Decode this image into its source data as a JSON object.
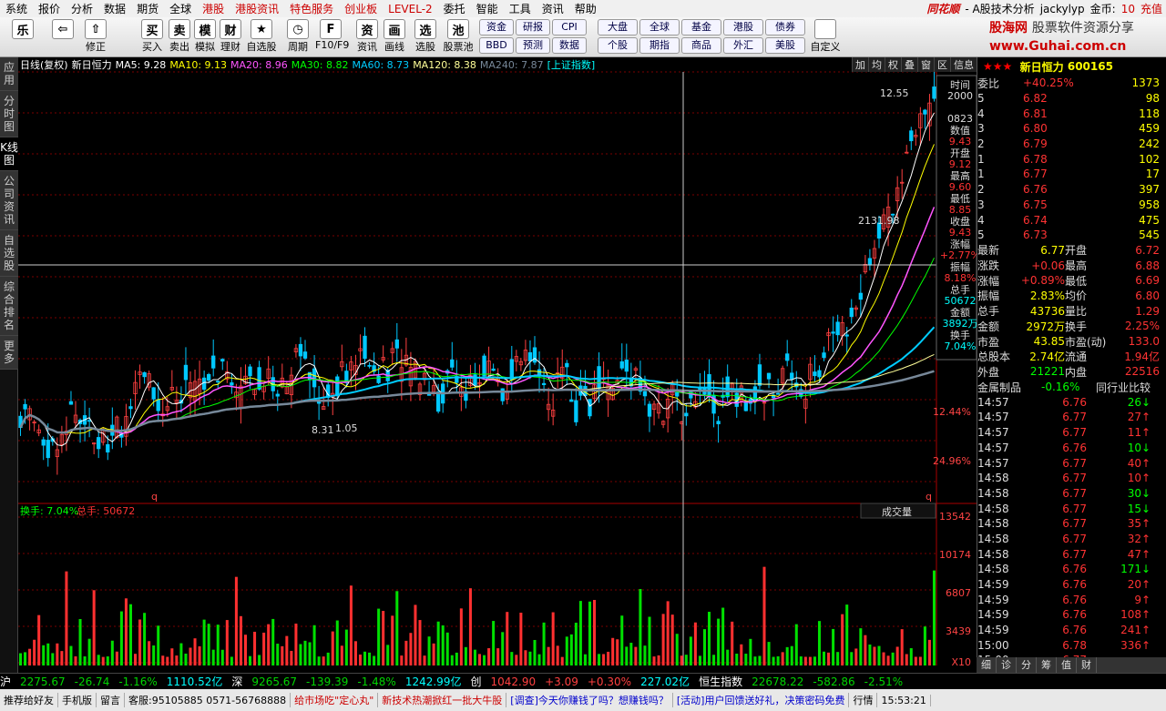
{
  "menu": [
    "系统",
    "报价",
    "分析",
    "数据",
    "期货",
    "全球",
    "港股",
    "港股资讯",
    "特色服务",
    "创业板",
    "LEVEL-2",
    "委托",
    "智能",
    "工具",
    "资讯",
    "帮助"
  ],
  "menu_red": [
    6,
    7,
    8,
    9,
    10
  ],
  "brand": "同花顺",
  "app_sub": "- A股技术分析",
  "user": "jackylyp",
  "coins_label": "金币:",
  "coins": "10",
  "recharge": "充值",
  "logo": {
    "line1": "股海网",
    "line2": "股票软件资源分享",
    "url": "www.Guhai.com.cn"
  },
  "toolbar": [
    {
      "icon": "乐",
      "label": ""
    },
    {
      "icon": "⇦",
      "label": ""
    },
    {
      "icon": "⇧",
      "label": "修正"
    },
    {
      "icon": "买",
      "label": "买入"
    },
    {
      "icon": "卖",
      "label": "卖出"
    },
    {
      "icon": "模",
      "label": "模拟"
    },
    {
      "icon": "财",
      "label": "理财"
    },
    {
      "icon": "★",
      "label": "自选股"
    },
    {
      "icon": "◷",
      "label": "周期"
    },
    {
      "icon": "F",
      "label": "F10/F9"
    },
    {
      "icon": "资",
      "label": "资讯"
    },
    {
      "icon": "画",
      "label": "画线"
    },
    {
      "icon": "选",
      "label": "选股"
    },
    {
      "icon": "池",
      "label": "股票池"
    }
  ],
  "toolbar_grid1": [
    "资金",
    "研报",
    "CPI",
    "BBD",
    "预测",
    "数据"
  ],
  "toolbar_grid2": [
    "大盘",
    "全球",
    "基金",
    "港股",
    "债券",
    "个股",
    "期指",
    "商品",
    "外汇",
    "美股"
  ],
  "toolbar_custom": "自定义",
  "sidebar": [
    "应用",
    "分时图",
    "K线图",
    "公司资讯",
    "自选股",
    "综合排名",
    "更多"
  ],
  "kline": {
    "period": "日线(复权)",
    "name": "新日恒力",
    "ma": [
      {
        "label": "MA5: 9.28",
        "color": "#ffffff"
      },
      {
        "label": "MA10: 9.13",
        "color": "#ffff00"
      },
      {
        "label": "MA20: 8.96",
        "color": "#ff55ff"
      },
      {
        "label": "MA30: 8.82",
        "color": "#00ff00"
      },
      {
        "label": "MA60: 8.73",
        "color": "#00ccff"
      },
      {
        "label": "MA120: 8.38",
        "color": "#ffff99"
      },
      {
        "label": "MA240: 7.87",
        "color": "#778899"
      }
    ],
    "overlay": "[上证指数]",
    "buttons": [
      "加",
      "均",
      "权",
      "叠",
      "窗",
      "区",
      "信息"
    ],
    "high_label": "12.55",
    "mid_label": "2131.98",
    "low_label": "8.31",
    "low2": "1.05",
    "pct_labels": [
      "12.44%",
      "24.96%"
    ],
    "q_left": "q",
    "q_right": "q"
  },
  "tooltip": [
    {
      "k": "时间",
      "v": "2000"
    },
    {
      "k": "",
      "v": "0823"
    },
    {
      "k": "数值",
      "v": "9.43"
    },
    {
      "k": "开盘",
      "v": "9.12"
    },
    {
      "k": "最高",
      "v": "9.60"
    },
    {
      "k": "最低",
      "v": "8.85"
    },
    {
      "k": "收盘",
      "v": "9.43"
    },
    {
      "k": "涨幅",
      "v": "+2.77%"
    },
    {
      "k": "振幅",
      "v": "8.18%"
    },
    {
      "k": "总手",
      "v": "50672"
    },
    {
      "k": "金额",
      "v": "3892万"
    },
    {
      "k": "换手",
      "v": "7.04%"
    }
  ],
  "volume": {
    "title_a": "换手: 7.04%",
    "title_b": "总手: 50672",
    "indicator": "成交量",
    "axis": [
      "13542",
      "10174",
      "6807",
      "3439",
      "X10"
    ]
  },
  "quote": {
    "stars": "★★★",
    "name": "新日恒力",
    "code": "600165",
    "webi_k": "委比",
    "webi": "+40.25%",
    "webi_v": "1373",
    "sells": [
      [
        "5",
        "6.82",
        "98"
      ],
      [
        "4",
        "6.81",
        "118"
      ],
      [
        "3",
        "6.80",
        "459"
      ],
      [
        "2",
        "6.79",
        "242"
      ],
      [
        "1",
        "6.78",
        "102"
      ]
    ],
    "buys": [
      [
        "1",
        "6.77",
        "17"
      ],
      [
        "2",
        "6.76",
        "397"
      ],
      [
        "3",
        "6.75",
        "958"
      ],
      [
        "4",
        "6.74",
        "475"
      ],
      [
        "5",
        "6.73",
        "545"
      ]
    ],
    "stats": [
      [
        "最新",
        "6.77",
        "开盘",
        "6.72"
      ],
      [
        "涨跌",
        "+0.06",
        "最高",
        "6.88"
      ],
      [
        "涨幅",
        "+0.89%",
        "最低",
        "6.69"
      ],
      [
        "振幅",
        "2.83%",
        "均价",
        "6.80"
      ],
      [
        "总手",
        "43736",
        "量比",
        "1.29"
      ],
      [
        "金额",
        "2972万",
        "换手",
        "2.25%"
      ],
      [
        "市盈",
        "43.85",
        "市盈(动)",
        "133.0"
      ],
      [
        "总股本",
        "2.74亿",
        "流通",
        "1.94亿"
      ],
      [
        "外盘",
        "21221",
        "内盘",
        "22516"
      ]
    ],
    "sector": "金属制品",
    "sector_chg": "-0.16%",
    "sector_cmp": "同行业比较",
    "ticks": [
      [
        "14:57",
        "6.76",
        "26",
        "d"
      ],
      [
        "14:57",
        "6.77",
        "27",
        "u"
      ],
      [
        "14:57",
        "6.77",
        "11",
        "u"
      ],
      [
        "14:57",
        "6.76",
        "10",
        "d"
      ],
      [
        "14:57",
        "6.77",
        "40",
        "u"
      ],
      [
        "14:58",
        "6.77",
        "10",
        "u"
      ],
      [
        "14:58",
        "6.77",
        "30",
        "d"
      ],
      [
        "14:58",
        "6.77",
        "15",
        "d"
      ],
      [
        "14:58",
        "6.77",
        "35",
        "u"
      ],
      [
        "14:58",
        "6.77",
        "32",
        "u"
      ],
      [
        "14:58",
        "6.77",
        "47",
        "u"
      ],
      [
        "14:58",
        "6.76",
        "171",
        "d"
      ],
      [
        "14:59",
        "6.76",
        "20",
        "u"
      ],
      [
        "14:59",
        "6.76",
        "9",
        "u"
      ],
      [
        "14:59",
        "6.76",
        "108",
        "u"
      ],
      [
        "14:59",
        "6.76",
        "241",
        "u"
      ],
      [
        "15:00",
        "6.78",
        "336",
        "u"
      ],
      [
        "15:00",
        "6.77",
        "",
        ""
      ]
    ],
    "tabs": [
      "细",
      "诊",
      "分",
      "筹",
      "值",
      "财"
    ]
  },
  "status": {
    "sh_label": "沪",
    "sh": "2275.67",
    "sh_chg": "-26.74",
    "sh_pct": "-1.16%",
    "sh_amt": "1110.52亿",
    "sz_label": "深",
    "sz": "9265.67",
    "sz_chg": "-139.39",
    "sz_pct": "-1.48%",
    "sz_amt": "1242.99亿",
    "cy_label": "创",
    "cy": "1042.90",
    "cy_chg": "+3.09",
    "cy_pct": "+0.30%",
    "cy_amt": "227.02亿",
    "hs_label": "恒生指数",
    "hs": "22678.22",
    "hs_chg": "-582.86",
    "hs_pct": "-2.51%"
  },
  "footer": [
    "推荐给好友",
    "手机版",
    "留言",
    "客服:95105885 0571-56768888",
    "给市场吃\"定心丸\"",
    "新技术热潮掀红一批大牛股",
    "[调查]今天你赚钱了吗？想赚钱吗？",
    "[活动]用户回馈送好礼，决策密码免费",
    "行情",
    "15:53:21"
  ],
  "colors": {
    "up": "#ff4040",
    "down": "#00d400",
    "bg": "#000000",
    "grid": "#aa0000"
  }
}
